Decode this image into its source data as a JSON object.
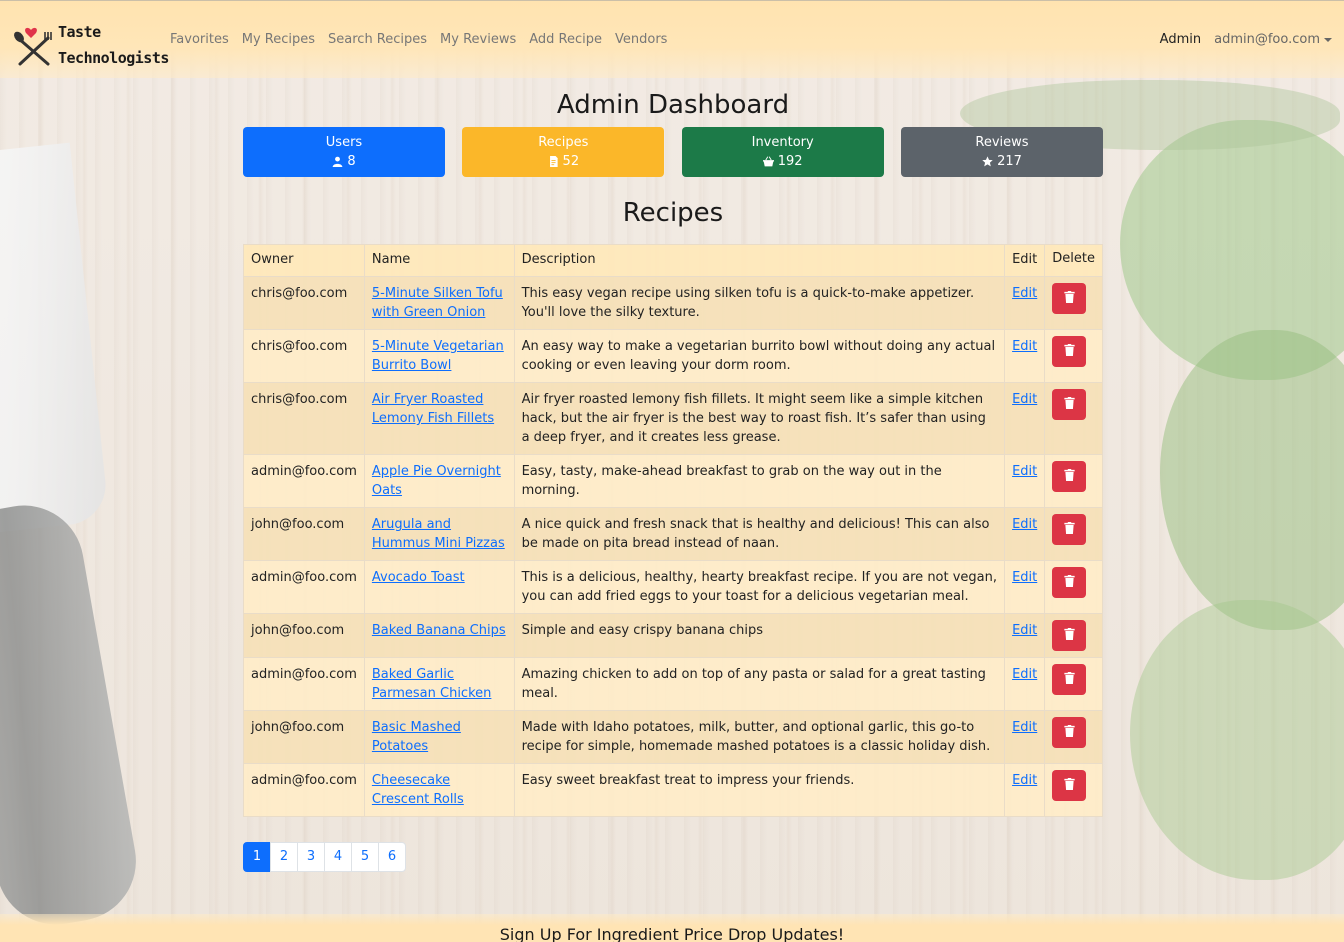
{
  "brand": {
    "line1": "Taste",
    "line2": "Technologists"
  },
  "nav": {
    "links": [
      "Favorites",
      "My Recipes",
      "Search Recipes",
      "My Reviews",
      "Add Recipe",
      "Vendors"
    ],
    "admin": "Admin",
    "user": "admin@foo.com"
  },
  "page_title": "Admin Dashboard",
  "stats": {
    "users": {
      "label": "Users",
      "value": "8",
      "icon": "person-icon",
      "color": "#0d6efd"
    },
    "recipes": {
      "label": "Recipes",
      "value": "52",
      "icon": "document-icon",
      "color": "#fbb729"
    },
    "inventory": {
      "label": "Inventory",
      "value": "192",
      "icon": "basket-icon",
      "color": "#1c7a48"
    },
    "reviews": {
      "label": "Reviews",
      "value": "217",
      "icon": "star-icon",
      "color": "#5c636a"
    }
  },
  "recipes_title": "Recipes",
  "table": {
    "headers": [
      "Owner",
      "Name",
      "Description",
      "Edit",
      "Delete"
    ],
    "edit_label": "Edit",
    "rows": [
      {
        "owner": "chris@foo.com",
        "name": "5-Minute Silken Tofu with Green Onion",
        "description": "This easy vegan recipe using silken tofu is a quick-to-make appetizer. You'll love the silky texture."
      },
      {
        "owner": "chris@foo.com",
        "name": "5-Minute Vegetarian Burrito Bowl",
        "description": "An easy way to make a vegetarian burrito bowl without doing any actual cooking or even leaving your dorm room."
      },
      {
        "owner": "chris@foo.com",
        "name": "Air Fryer Roasted Lemony Fish Fillets",
        "description": "Air fryer roasted lemony fish fillets. It might seem like a simple kitchen hack, but the air fryer is the best way to roast fish. It’s safer than using a deep fryer, and it creates less grease."
      },
      {
        "owner": "admin@foo.com",
        "name": "Apple Pie Overnight Oats",
        "description": "Easy, tasty, make-ahead breakfast to grab on the way out in the morning."
      },
      {
        "owner": "john@foo.com",
        "name": "Arugula and Hummus Mini Pizzas",
        "description": "A nice quick and fresh snack that is healthy and delicious! This can also be made on pita bread instead of naan."
      },
      {
        "owner": "admin@foo.com",
        "name": "Avocado Toast",
        "description": "This is a delicious, healthy, hearty breakfast recipe. If you are not vegan, you can add fried eggs to your toast for a delicious vegetarian meal."
      },
      {
        "owner": "john@foo.com",
        "name": "Baked Banana Chips",
        "description": "Simple and easy crispy banana chips"
      },
      {
        "owner": "admin@foo.com",
        "name": "Baked Garlic Parmesan Chicken",
        "description": "Amazing chicken to add on top of any pasta or salad for a great tasting meal."
      },
      {
        "owner": "john@foo.com",
        "name": "Basic Mashed Potatoes",
        "description": "Made with Idaho potatoes, milk, butter, and optional garlic, this go-to recipe for simple, homemade mashed potatoes is a classic holiday dish."
      },
      {
        "owner": "admin@foo.com",
        "name": "Cheesecake Crescent Rolls",
        "description": "Easy sweet breakfast treat to impress your friends."
      }
    ]
  },
  "pagination": {
    "pages": [
      "1",
      "2",
      "3",
      "4",
      "5",
      "6"
    ],
    "active": "1"
  },
  "footer": {
    "text": "Sign Up For Ingredient Price Drop Updates!"
  }
}
